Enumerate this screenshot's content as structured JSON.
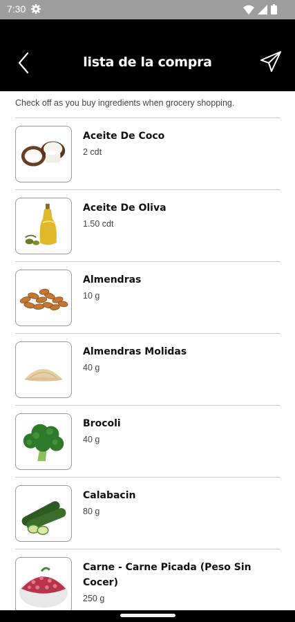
{
  "status_bar": {
    "time": "7:30"
  },
  "header": {
    "title": "lista de la compra",
    "back_icon": "chevron-left-icon",
    "share_icon": "paper-plane-icon"
  },
  "hint": "Check off as you buy ingredients when grocery shopping.",
  "items": [
    {
      "name": "Aceite De Coco",
      "qty": "2 cdt"
    },
    {
      "name": "Aceite De Oliva",
      "qty": "1.50 cdt"
    },
    {
      "name": "Almendras",
      "qty": "10 g"
    },
    {
      "name": "Almendras Molidas",
      "qty": "40 g"
    },
    {
      "name": "Brocoli",
      "qty": "40 g"
    },
    {
      "name": "Calabacin",
      "qty": "80 g"
    },
    {
      "name": "Carne - Carne Picada (Peso Sin Cocer)",
      "qty": "250 g"
    }
  ],
  "colors": {
    "app_bar": "#000000",
    "status_bar": "#9e9e9e",
    "divider": "#c9c9c9",
    "thumb_border": "#9a9a9a"
  }
}
